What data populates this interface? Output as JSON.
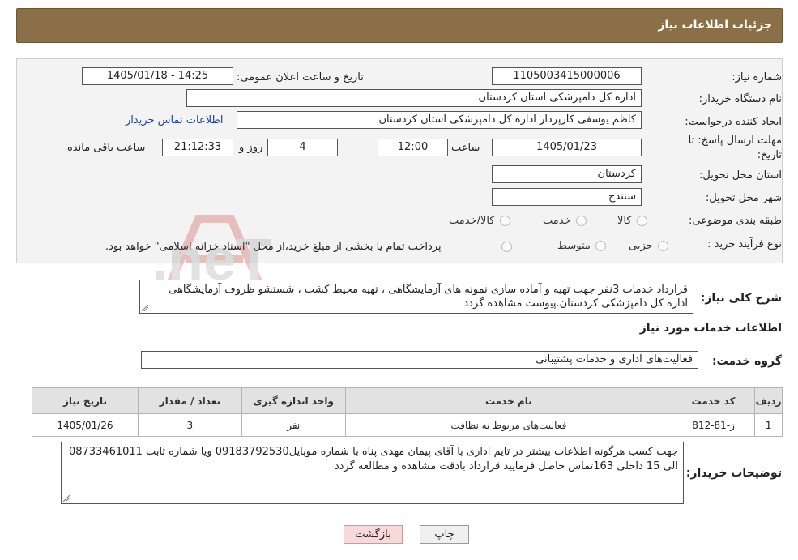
{
  "header": {
    "title": "جزئیات اطلاعات نیاز"
  },
  "form": {
    "need_number_label": "شماره نیاز:",
    "need_number": "1105003415000006",
    "announce_label": "تاریخ و ساعت اعلان عمومی:",
    "announce_value": "1405/01/18 - 14:25",
    "buyer_label": "نام دستگاه خریدار:",
    "buyer_value": "اداره کل دامپزشکی استان کردستان",
    "creator_label": "ایجاد کننده درخواست:",
    "creator_value": "کاظم یوسفی کارپرداز اداره کل دامپزشکی استان کردستان",
    "contact_link": "اطلاعات تماس خریدار",
    "deadline_label_1": "مهلت ارسال پاسخ: تا",
    "deadline_label_2": "تاریخ:",
    "deadline_date": "1405/01/23",
    "time_label": "ساعت",
    "deadline_time": "12:00",
    "days_value": "4",
    "days_label": "روز و",
    "remaining_time": "21:12:33",
    "remaining_label": "ساعت باقی مانده",
    "province_label": "استان محل تحویل:",
    "province_value": "کردستان",
    "city_label": "شهر محل تحویل:",
    "city_value": "سنندج",
    "category_label": "طبقه بندی موضوعی:",
    "category_options": [
      "کالا",
      "خدمت",
      "کالا/خدمت"
    ],
    "process_label": "نوع فرآیند خرید :",
    "process_options": [
      "جزیی",
      "متوسط"
    ],
    "process_note": "پرداخت تمام یا بخشی از مبلغ خرید،از محل \"اسناد خزانه اسلامی\" خواهد بود."
  },
  "description": {
    "label": "شرح کلی نیاز:",
    "text": "قرارداد خدمات  3نفر جهت تهیه و آماده سازی نمونه های آزمایشگاهی ، تهیه محیط کشت ، شستشو  ظروف آزمایشگاهی اداره کل دامپزشکی کردستان.پیوست مشاهده گردد"
  },
  "services": {
    "section_title": "اطلاعات خدمات مورد نیاز",
    "group_label": "گروه خدمت:",
    "group_value": "فعالیت‌های اداری و خدمات پشتیبانی",
    "columns": [
      "ردیف",
      "کد خدمت",
      "نام خدمت",
      "واحد اندازه گیری",
      "تعداد / مقدار",
      "تاریخ نیاز"
    ],
    "rows": [
      [
        "1",
        "ز-81-812",
        "فعالیت‌های مربوط به نظافت",
        "نفر",
        "3",
        "1405/01/26"
      ]
    ]
  },
  "notes": {
    "label": "توضیحات خریدار:",
    "text": "جهت کسب هرگونه اطلاعات بیشتر در تایم اداری با آقای  پیمان مهدی پناه با شماره موبایل09183792530 ویا شماره ثابت 08733461011 الی 15 داخلی 163تماس حاصل فرمایید قرارداد بادقت مشاهده و مطالعه گردد"
  },
  "buttons": {
    "print": "چاپ",
    "back": "بازگشت"
  },
  "watermark": {
    "text": "AriaTender.neT"
  },
  "colors": {
    "header_bg": "#8b6f47",
    "link": "#1a3fb0",
    "back_button": "#f8d8d8"
  }
}
